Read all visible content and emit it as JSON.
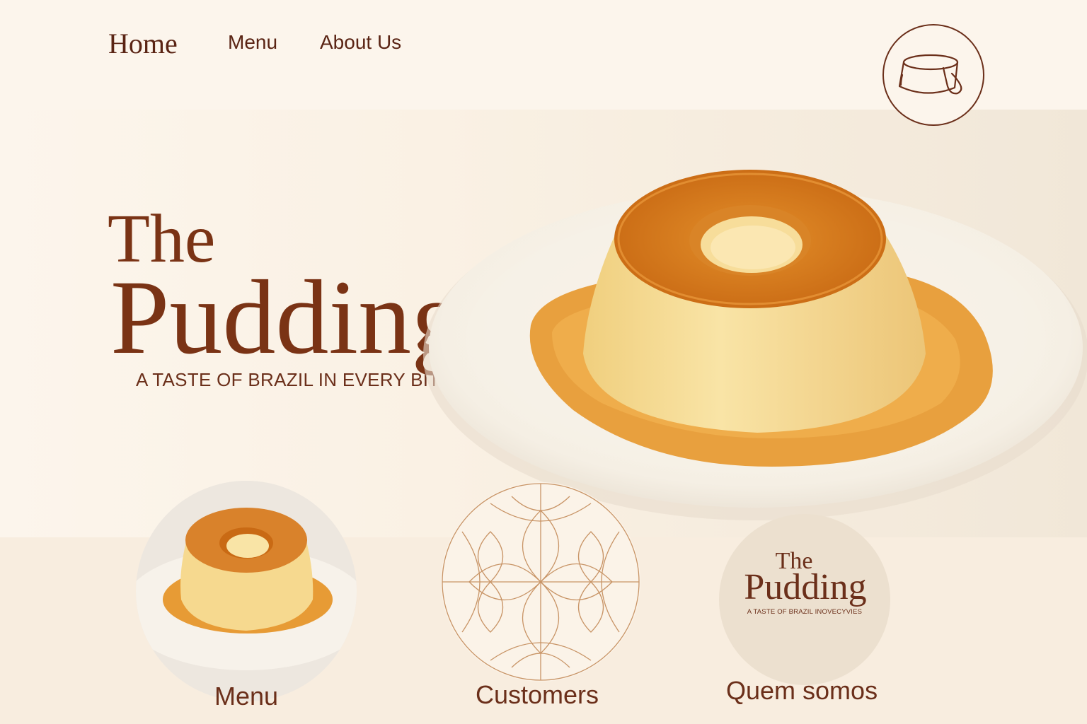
{
  "nav": {
    "home": "Home",
    "menu": "Menu",
    "about": "About Us"
  },
  "logo_icon": "pudding-outline-icon",
  "hero": {
    "title_line1": "The",
    "title_line2": "Pudding",
    "tagline": "A TASTE OF BRAZIL IN EVERY BITE"
  },
  "cards": {
    "menu_label": "Menu",
    "customers_label": "Customers",
    "about_label": "Quem somos",
    "about_logo_line1": "The",
    "about_logo_line2": "Pudding",
    "about_logo_tagline": "A TASTE OF BRAZIL INOVECYVIES"
  },
  "colors": {
    "brand_brown": "#6b2f1a",
    "caramel": "#d9822b",
    "custard": "#f6d98f",
    "background": "#fbf3e8"
  }
}
